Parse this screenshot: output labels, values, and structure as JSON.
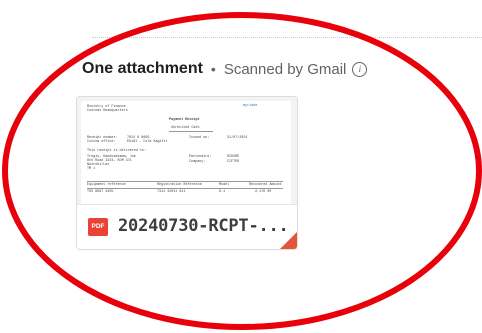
{
  "attachments": {
    "title": "One attachment",
    "separator": "•",
    "scanned_text": "Scanned by Gmail",
    "info_icon_glyph": "i"
  },
  "file": {
    "type_label": "PDF",
    "name": "20240730-RCPT-...",
    "icon": "pdf-icon"
  },
  "preview": {
    "org_line1": "Ministry of Finance",
    "org_line2": "Customs Headquarters",
    "logo_text": "myriade",
    "title": "Payment Receipt",
    "subtitle": "Unrecited Cash",
    "receipt_number_label": "Receipt number:",
    "receipt_number_value": "7024 6 8669",
    "issue_label": "Issued on:",
    "issue_value": "31/07/2024",
    "station_label": "Custom office:",
    "station_value": "E6161 - Cola Kagifir",
    "issued_to_label": "This receipt is delivered to:",
    "payee_line1": "Tregio, Kamikakkama, Joe",
    "payee_line2": "6th Road 3224, KOM 371",
    "payee_line3": "Nairobi/Leo",
    "payee_line4": "TM 1",
    "partner_label": "Partenaire:",
    "partner_value": "RIDORE",
    "company_label": "Company:",
    "company_value": "CIFTER",
    "col1": "Equipment reference",
    "col2": "Registration Reference",
    "col3": "Model",
    "col4": "Recovered Amount",
    "row_v1": "TX5 8697 4455",
    "row_v2": "7311 42011 811",
    "row_v3": "K.1",
    "row_v4": "2,176 00"
  },
  "colors": {
    "annotation": "#e8000b",
    "pdf_red": "#ea4335"
  }
}
